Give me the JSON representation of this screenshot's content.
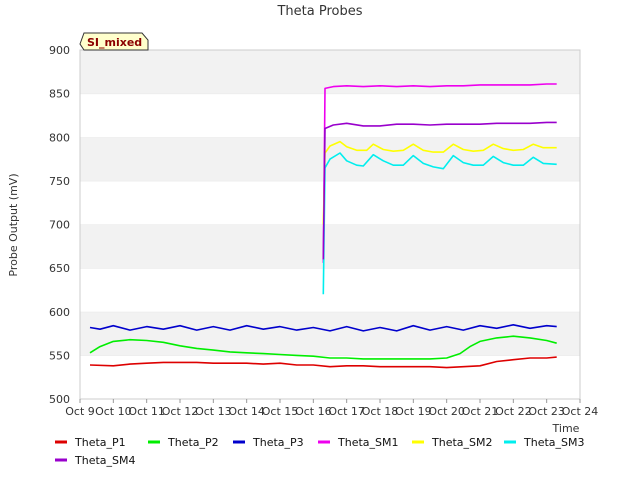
{
  "chart_data": {
    "type": "line",
    "title": "Theta Probes",
    "badge": "SI_mixed",
    "xlabel": "Time",
    "ylabel": "Probe Output (mV)",
    "ylim": [
      500,
      900
    ],
    "yticks": [
      500,
      550,
      600,
      650,
      700,
      750,
      800,
      850,
      900
    ],
    "xlim": [
      9,
      24
    ],
    "xticks": [
      {
        "v": 9,
        "label": "Oct 9"
      },
      {
        "v": 10,
        "label": "Oct 10"
      },
      {
        "v": 11,
        "label": "Oct 11"
      },
      {
        "v": 12,
        "label": "Oct 12"
      },
      {
        "v": 13,
        "label": "Oct 13"
      },
      {
        "v": 14,
        "label": "Oct 14"
      },
      {
        "v": 15,
        "label": "Oct 15"
      },
      {
        "v": 16,
        "label": "Oct 16"
      },
      {
        "v": 17,
        "label": "Oct 17"
      },
      {
        "v": 18,
        "label": "Oct 18"
      },
      {
        "v": 19,
        "label": "Oct 19"
      },
      {
        "v": 20,
        "label": "Oct 20"
      },
      {
        "v": 21,
        "label": "Oct 21"
      },
      {
        "v": 22,
        "label": "Oct 22"
      },
      {
        "v": 23,
        "label": "Oct 23"
      },
      {
        "v": 24,
        "label": "Oct 24"
      }
    ],
    "grid": "horizontal bands",
    "legend_position": "bottom",
    "series": [
      {
        "name": "Theta_P1",
        "color": "#dd0000",
        "points": [
          [
            9.3,
            539
          ],
          [
            10,
            538
          ],
          [
            10.5,
            540
          ],
          [
            11,
            541
          ],
          [
            11.5,
            542
          ],
          [
            12,
            542
          ],
          [
            12.5,
            542
          ],
          [
            13,
            541
          ],
          [
            13.5,
            541
          ],
          [
            14,
            541
          ],
          [
            14.5,
            540
          ],
          [
            15,
            541
          ],
          [
            15.5,
            539
          ],
          [
            16,
            539
          ],
          [
            16.5,
            537
          ],
          [
            17,
            538
          ],
          [
            17.5,
            538
          ],
          [
            18,
            537
          ],
          [
            18.5,
            537
          ],
          [
            19,
            537
          ],
          [
            19.5,
            537
          ],
          [
            20,
            536
          ],
          [
            20.5,
            537
          ],
          [
            21,
            538
          ],
          [
            21.5,
            543
          ],
          [
            22,
            545
          ],
          [
            22.5,
            547
          ],
          [
            23,
            547
          ],
          [
            23.3,
            548
          ]
        ]
      },
      {
        "name": "Theta_P2",
        "color": "#00ee00",
        "points": [
          [
            9.3,
            553
          ],
          [
            9.6,
            560
          ],
          [
            10,
            566
          ],
          [
            10.5,
            568
          ],
          [
            11,
            567
          ],
          [
            11.5,
            565
          ],
          [
            12,
            561
          ],
          [
            12.5,
            558
          ],
          [
            13,
            556
          ],
          [
            13.5,
            554
          ],
          [
            14,
            553
          ],
          [
            14.5,
            552
          ],
          [
            15,
            551
          ],
          [
            15.5,
            550
          ],
          [
            16,
            549
          ],
          [
            16.5,
            547
          ],
          [
            17,
            547
          ],
          [
            17.5,
            546
          ],
          [
            18,
            546
          ],
          [
            18.5,
            546
          ],
          [
            19,
            546
          ],
          [
            19.5,
            546
          ],
          [
            20,
            547
          ],
          [
            20.4,
            552
          ],
          [
            20.7,
            560
          ],
          [
            21,
            566
          ],
          [
            21.5,
            570
          ],
          [
            22,
            572
          ],
          [
            22.5,
            570
          ],
          [
            23,
            567
          ],
          [
            23.3,
            564
          ]
        ]
      },
      {
        "name": "Theta_P3",
        "color": "#0000cc",
        "points": [
          [
            9.3,
            582
          ],
          [
            9.6,
            580
          ],
          [
            10,
            584
          ],
          [
            10.5,
            579
          ],
          [
            11,
            583
          ],
          [
            11.5,
            580
          ],
          [
            12,
            584
          ],
          [
            12.5,
            579
          ],
          [
            13,
            583
          ],
          [
            13.5,
            579
          ],
          [
            14,
            584
          ],
          [
            14.5,
            580
          ],
          [
            15,
            583
          ],
          [
            15.5,
            579
          ],
          [
            16,
            582
          ],
          [
            16.5,
            578
          ],
          [
            17,
            583
          ],
          [
            17.5,
            578
          ],
          [
            18,
            582
          ],
          [
            18.5,
            578
          ],
          [
            19,
            584
          ],
          [
            19.5,
            579
          ],
          [
            20,
            583
          ],
          [
            20.5,
            579
          ],
          [
            21,
            584
          ],
          [
            21.5,
            581
          ],
          [
            22,
            585
          ],
          [
            22.5,
            581
          ],
          [
            23,
            584
          ],
          [
            23.3,
            583
          ]
        ]
      },
      {
        "name": "Theta_SM1",
        "color": "#ee00ee",
        "points": [
          [
            16.3,
            656
          ],
          [
            16.35,
            856
          ],
          [
            16.6,
            858
          ],
          [
            17,
            859
          ],
          [
            17.5,
            858
          ],
          [
            18,
            859
          ],
          [
            18.5,
            858
          ],
          [
            19,
            859
          ],
          [
            19.5,
            858
          ],
          [
            20,
            859
          ],
          [
            20.5,
            859
          ],
          [
            21,
            860
          ],
          [
            21.5,
            860
          ],
          [
            22,
            860
          ],
          [
            22.5,
            860
          ],
          [
            23,
            861
          ],
          [
            23.3,
            861
          ]
        ]
      },
      {
        "name": "Theta_SM2",
        "color": "#ffff00",
        "points": [
          [
            16.3,
            700
          ],
          [
            16.35,
            782
          ],
          [
            16.5,
            790
          ],
          [
            16.8,
            795
          ],
          [
            17,
            789
          ],
          [
            17.3,
            785
          ],
          [
            17.6,
            785
          ],
          [
            17.8,
            792
          ],
          [
            18.1,
            786
          ],
          [
            18.4,
            784
          ],
          [
            18.7,
            785
          ],
          [
            19,
            792
          ],
          [
            19.3,
            785
          ],
          [
            19.6,
            783
          ],
          [
            19.9,
            783
          ],
          [
            20.2,
            792
          ],
          [
            20.5,
            786
          ],
          [
            20.8,
            784
          ],
          [
            21.1,
            785
          ],
          [
            21.4,
            792
          ],
          [
            21.7,
            787
          ],
          [
            22,
            785
          ],
          [
            22.3,
            786
          ],
          [
            22.6,
            792
          ],
          [
            22.9,
            788
          ],
          [
            23.3,
            788
          ]
        ]
      },
      {
        "name": "Theta_SM3",
        "color": "#00eeee",
        "points": [
          [
            16.3,
            620
          ],
          [
            16.35,
            765
          ],
          [
            16.5,
            775
          ],
          [
            16.8,
            782
          ],
          [
            17,
            773
          ],
          [
            17.3,
            768
          ],
          [
            17.5,
            767
          ],
          [
            17.8,
            780
          ],
          [
            18.1,
            773
          ],
          [
            18.4,
            768
          ],
          [
            18.7,
            768
          ],
          [
            19,
            779
          ],
          [
            19.3,
            770
          ],
          [
            19.6,
            766
          ],
          [
            19.9,
            764
          ],
          [
            20.2,
            779
          ],
          [
            20.5,
            771
          ],
          [
            20.8,
            768
          ],
          [
            21.1,
            768
          ],
          [
            21.4,
            778
          ],
          [
            21.7,
            771
          ],
          [
            22,
            768
          ],
          [
            22.3,
            768
          ],
          [
            22.6,
            777
          ],
          [
            22.9,
            770
          ],
          [
            23.3,
            769
          ]
        ]
      },
      {
        "name": "Theta_SM4",
        "color": "#9900cc",
        "points": [
          [
            16.3,
            660
          ],
          [
            16.35,
            810
          ],
          [
            16.6,
            814
          ],
          [
            17,
            816
          ],
          [
            17.5,
            813
          ],
          [
            18,
            813
          ],
          [
            18.5,
            815
          ],
          [
            19,
            815
          ],
          [
            19.5,
            814
          ],
          [
            20,
            815
          ],
          [
            20.5,
            815
          ],
          [
            21,
            815
          ],
          [
            21.5,
            816
          ],
          [
            22,
            816
          ],
          [
            22.5,
            816
          ],
          [
            23,
            817
          ],
          [
            23.3,
            817
          ]
        ]
      }
    ]
  }
}
